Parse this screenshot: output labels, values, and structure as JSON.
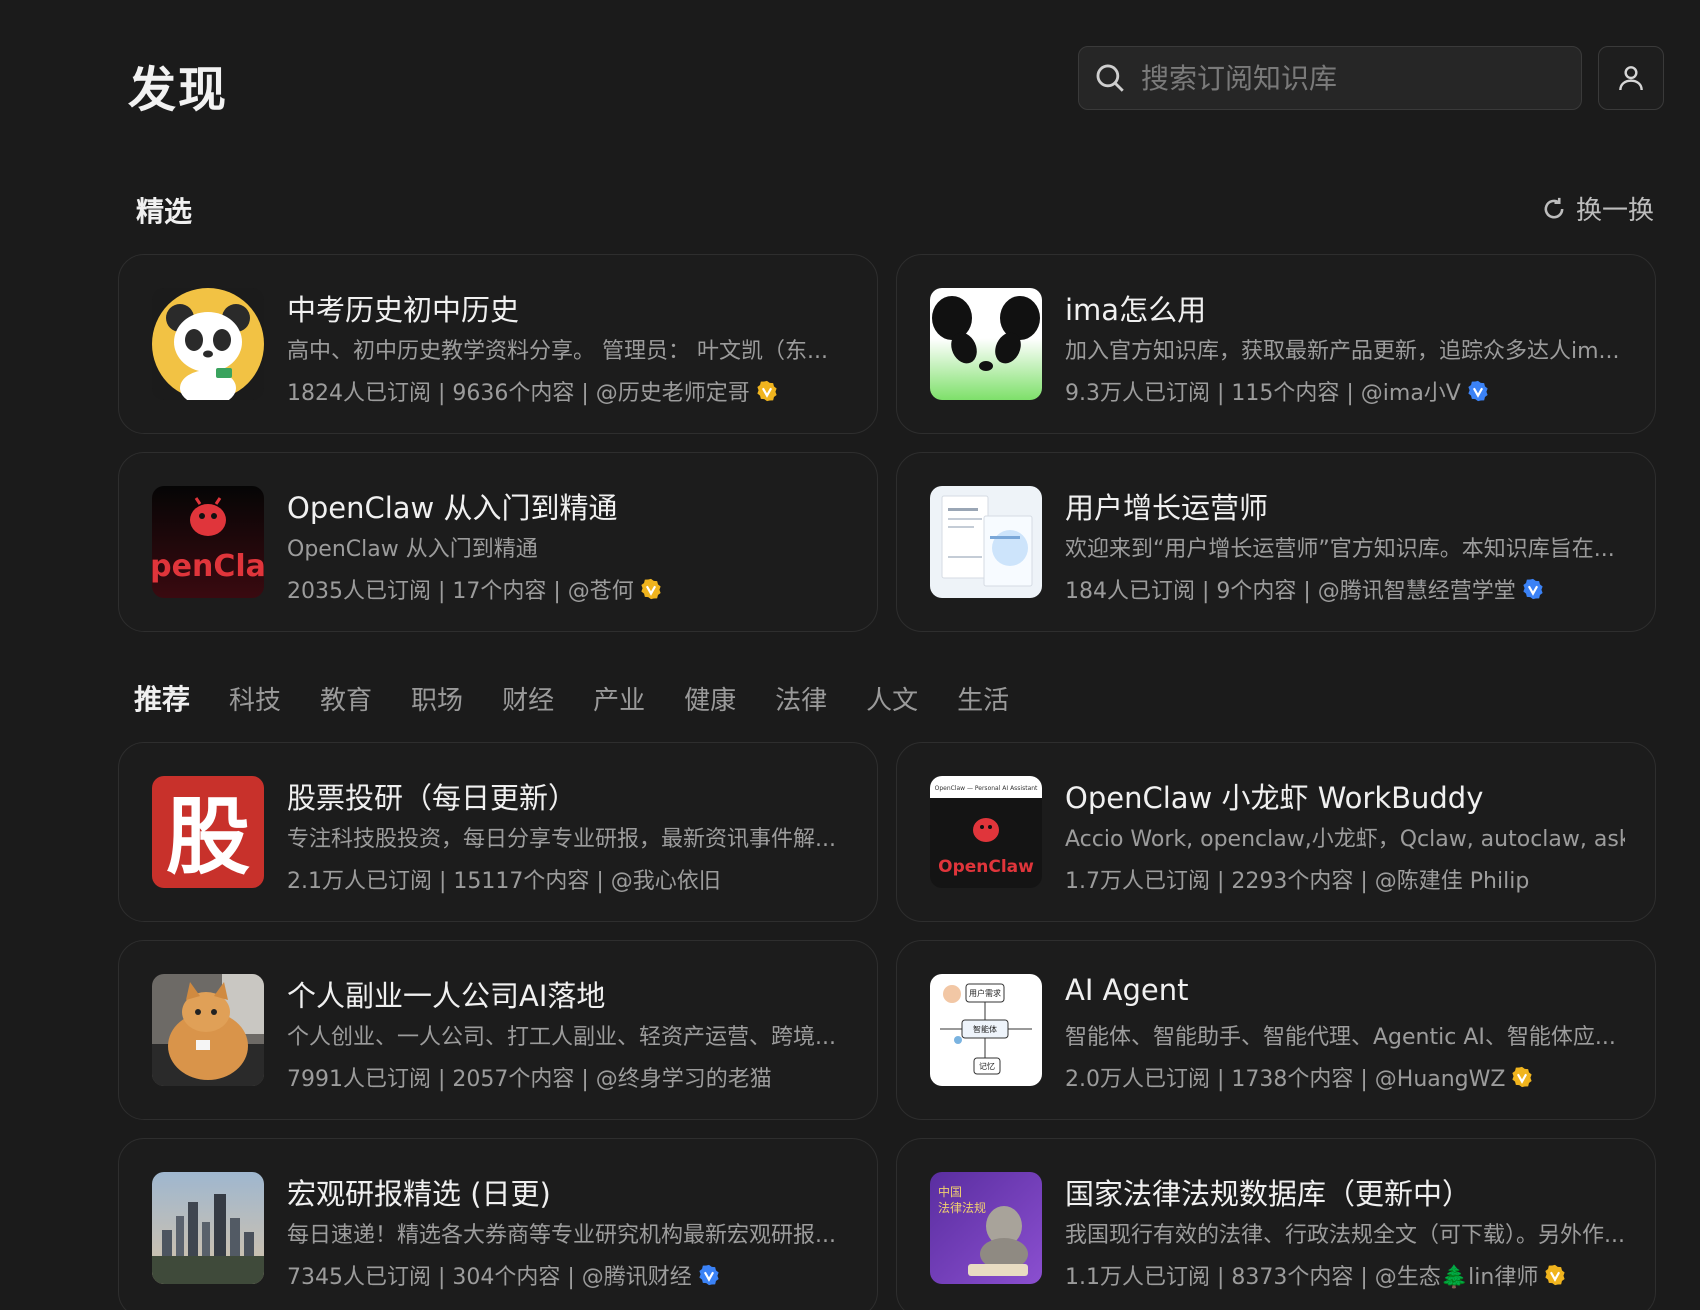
{
  "header": {
    "title": "发现",
    "search_placeholder": "搜索订阅知识库"
  },
  "featured": {
    "title": "精选",
    "refresh_label": "换一换",
    "cards": [
      {
        "title": "中考历史初中历史",
        "desc": "高中、初中历史教学资料分享。 管理员： 叶文凯（东...",
        "meta": "1824人已订阅 | 9636个内容 | @历史老师定哥",
        "badge": "gold"
      },
      {
        "title": "ima怎么用",
        "desc": "加入官方知识库，获取最新产品更新，追踪众多达人im...",
        "meta": "9.3万人已订阅 | 115个内容 | @ima小V",
        "badge": "blue"
      },
      {
        "title": "OpenClaw 从入门到精通",
        "desc": "OpenClaw 从入门到精通",
        "meta": "2035人已订阅 | 17个内容 | @苍何",
        "badge": "gold",
        "thumb_text": "penCla"
      },
      {
        "title": "用户增长运营师",
        "desc": "欢迎来到“用户增长运营师”官方知识库。本知识库旨在...",
        "meta": "184人已订阅 | 9个内容 | @腾讯智慧经营学堂",
        "badge": "blue"
      }
    ]
  },
  "recommend": {
    "tabs": [
      "推荐",
      "科技",
      "教育",
      "职场",
      "财经",
      "产业",
      "健康",
      "法律",
      "人文",
      "生活"
    ],
    "active_tab": 0,
    "cards": [
      {
        "title": "股票投研（每日更新）",
        "desc": "专注科技股投资，每日分享专业研报，最新资讯事件解...",
        "meta": "2.1万人已订阅 | 15117个内容 | @我心依旧",
        "badge": "",
        "thumb_text": "股"
      },
      {
        "title": "OpenClaw 小龙虾 WorkBuddy",
        "desc": "Accio Work, openclaw,小龙虾，Qclaw, autoclaw, ask...",
        "meta": "1.7万人已订阅 | 2293个内容 | @陈建佳 Philip",
        "badge": "",
        "thumb_text": "OpenClaw",
        "thumb_caption": "OpenClaw — Personal AI Assistant"
      },
      {
        "title": "个人副业一人公司AI落地",
        "desc": "个人创业、一人公司、打工人副业、轻资产运营、跨境...",
        "meta": "7991人已订阅 | 2057个内容 | @终身学习的老猫",
        "badge": ""
      },
      {
        "title": "AI Agent",
        "desc": "智能体、智能助手、智能代理、Agentic AI、智能体应...",
        "meta": "2.0万人已订阅 | 1738个内容 | @HuangWZ",
        "badge": "gold",
        "thumb_labels": [
          "用户需求",
          "智能体",
          "记忆"
        ]
      },
      {
        "title": "宏观研报精选 (日更)",
        "desc": "每日速递！精选各大券商等专业研究机构最新宏观研报...",
        "meta": "7345人已订阅 | 304个内容 | @腾讯财经",
        "badge": "blue"
      },
      {
        "title": "国家法律法规数据库（更新中）",
        "desc": "我国现行有效的法律、行政法规全文（可下载）。另外作...",
        "meta": "1.1万人已订阅 | 8373个内容 | @生态🌲lin律师",
        "badge": "gold",
        "thumb_labels": [
          "中国",
          "法律法规"
        ]
      }
    ]
  },
  "colors": {
    "gold": "#f0b41e",
    "blue": "#3b82f6",
    "background": "#1b1b1b"
  }
}
